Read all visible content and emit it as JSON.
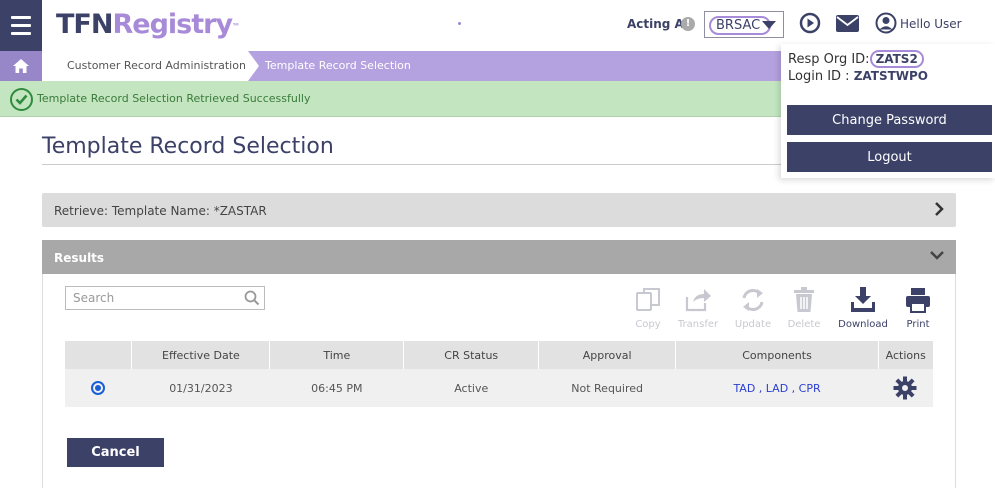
{
  "header": {
    "logo_part1": "TFN",
    "logo_part2": "Registry",
    "logo_tm": "™",
    "acting_as_label": "Acting As",
    "acting_as_value": "BRSAC",
    "hello_user": "Hello User"
  },
  "breadcrumb": {
    "items": [
      "Customer Record Administration",
      "Template Record Selection"
    ]
  },
  "alert": {
    "message": "Template Record Selection Retrieved Successfully"
  },
  "page": {
    "title": "Template Record Selection"
  },
  "retrieve": {
    "label": "Retrieve: Template Name: *ZASTAR"
  },
  "results": {
    "label": "Results",
    "search_placeholder": "Search",
    "toolbar": {
      "copy": "Copy",
      "transfer": "Transfer",
      "update": "Update",
      "delete": "Delete",
      "download": "Download",
      "print": "Print"
    },
    "columns": [
      "",
      "Effective Date",
      "Time",
      "CR Status",
      "Approval",
      "Components",
      "Actions"
    ],
    "rows": [
      {
        "effective_date": "01/31/2023",
        "time": "06:45 PM",
        "cr_status": "Active",
        "approval": "Not Required",
        "components": "TAD , LAD , CPR"
      }
    ]
  },
  "cancel_label": "Cancel",
  "user_menu": {
    "resp_org_label": "Resp Org ID:",
    "resp_org_value": "ZATS2",
    "login_label": "Login ID :",
    "login_value": "ZATSTWPO",
    "change_password": "Change Password",
    "logout": "Logout"
  },
  "colors": {
    "brand_navy": "#3c4168",
    "brand_purple": "#a78bd8",
    "success_bg": "#c3e6c0",
    "link_blue": "#2a3fd0"
  }
}
